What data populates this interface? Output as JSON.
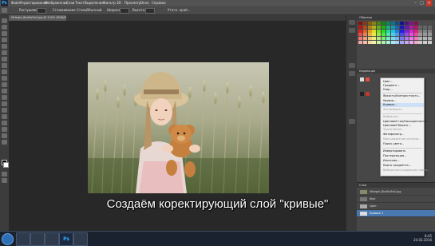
{
  "menubar": {
    "logo": "Ps",
    "items": [
      "Файл",
      "Редактирование",
      "Изображение",
      "Слои",
      "Текст",
      "Выделение",
      "Фильтр",
      "3D",
      "Просмотр",
      "Окно",
      "Справка"
    ]
  },
  "options_bar": {
    "items": [
      "Растушевка:",
      "Сглаживание",
      "Стиль:",
      "Обычный",
      "Ширина:",
      "Высота:",
      "Уточн. край..."
    ]
  },
  "document": {
    "tab_label": "littlegirl_8bd5a5b4.jpg @ 100% (RGB/8*)"
  },
  "caption": "Создаём коректирующий слой \"кривые\"",
  "adjust_menu": {
    "items": [
      {
        "label": "Цвет...",
        "state": "normal"
      },
      {
        "label": "Градиент...",
        "state": "normal"
      },
      {
        "label": "Узор...",
        "state": "normal"
      },
      {
        "label": "Яркость/Контрастность...",
        "state": "normal"
      },
      {
        "label": "Уровни...",
        "state": "normal"
      },
      {
        "label": "Кривые...",
        "state": "highlight"
      },
      {
        "label": "Экспозиция...",
        "state": "disabled"
      },
      {
        "label": "Вибрация...",
        "state": "disabled"
      },
      {
        "label": "Цветовой тон/Насыщенность...",
        "state": "normal"
      },
      {
        "label": "Цветовой баланс...",
        "state": "normal"
      },
      {
        "label": "Черно-белое...",
        "state": "disabled"
      },
      {
        "label": "Фотофильтр...",
        "state": "normal"
      },
      {
        "label": "Микширование каналов...",
        "state": "disabled"
      },
      {
        "label": "Поиск цвета...",
        "state": "normal"
      },
      {
        "label": "Инвертировать",
        "state": "normal"
      },
      {
        "label": "Постеризация...",
        "state": "normal"
      },
      {
        "label": "Изогелия...",
        "state": "normal"
      },
      {
        "label": "Карта градиента...",
        "state": "normal"
      },
      {
        "label": "Выборочная коррекция цвета...",
        "state": "disabled"
      }
    ]
  },
  "layers_panel": {
    "title": "Слои",
    "rows": [
      {
        "label": "littlegirl_8bd5a5b4.jpg",
        "selected": false
      },
      {
        "label": "Фон",
        "selected": false
      },
      {
        "label": "Цвет",
        "selected": false
      },
      {
        "label": "Кривые 1",
        "selected": true
      }
    ]
  },
  "panels": {
    "swatches_title": "Образцы",
    "adjust_title": "Коррекция"
  },
  "taskbar": {
    "ps_label": "Ps",
    "time": "8:45",
    "date": "24.03.2016"
  },
  "colors": {
    "accent": "#31a8ff",
    "highlight": "#cde0f7",
    "layer_selected": "#4a78b0"
  }
}
